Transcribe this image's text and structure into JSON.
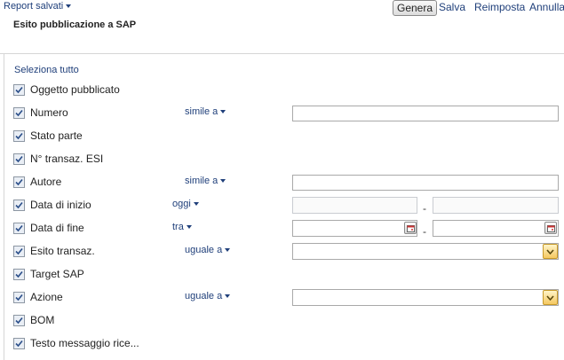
{
  "toolbar": {
    "saved_reports_label": "Report salvati",
    "genera_label": "Genera",
    "salva_label": "Salva",
    "reimposta_label": "Reimposta",
    "annulla_label": "Annulla"
  },
  "page_title": "Esito pubblicazione a SAP",
  "select_all_label": "Seleziona tutto",
  "fields": [
    {
      "label": "Oggetto pubblicato",
      "checked": true
    },
    {
      "label": "Numero",
      "checked": true,
      "operator": "simile a",
      "value": ""
    },
    {
      "label": "Stato parte",
      "checked": true
    },
    {
      "label": "N° transaz. ESI",
      "checked": true
    },
    {
      "label": "Autore",
      "checked": true,
      "operator": "simile a",
      "value": ""
    },
    {
      "label": "Data di inizio",
      "checked": true,
      "operator": "oggi",
      "range_separator": "-"
    },
    {
      "label": "Data di fine",
      "checked": true,
      "operator": "tra",
      "range_separator": "-"
    },
    {
      "label": "Esito transaz.",
      "checked": true,
      "operator": "uguale a",
      "selected": ""
    },
    {
      "label": "Target SAP",
      "checked": true
    },
    {
      "label": "Azione",
      "checked": true,
      "operator": "uguale a",
      "selected": ""
    },
    {
      "label": "BOM",
      "checked": true
    },
    {
      "label": "Testo messaggio rice...",
      "checked": true
    }
  ],
  "icons": {
    "checkbox": "checkmark-icon",
    "calendar": "calendar-icon",
    "dropdown": "chevron-down-icon",
    "menu_caret": "caret-down-icon"
  },
  "colors": {
    "link": "#1f3f7a",
    "dropdown_button": "#f5c860"
  }
}
